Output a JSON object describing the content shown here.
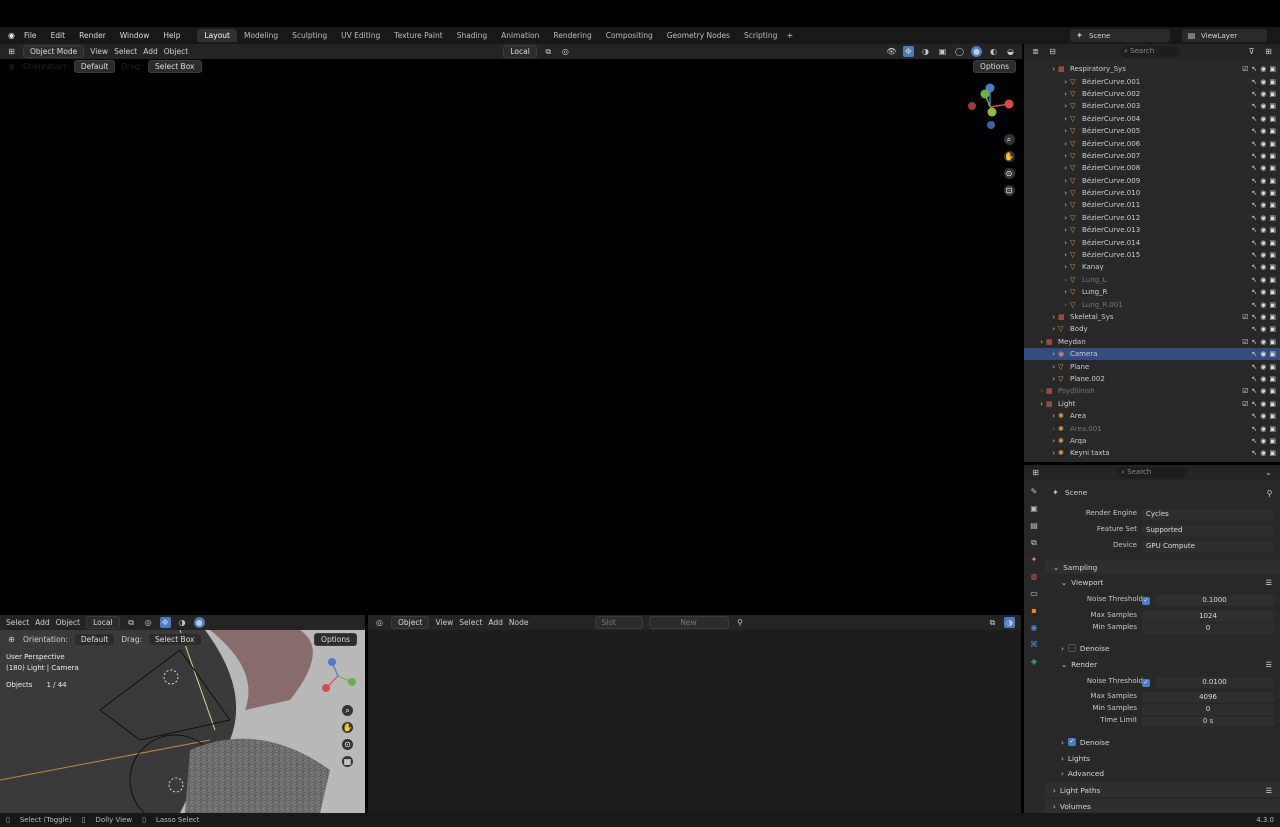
{
  "menu": [
    "File",
    "Edit",
    "Render",
    "Window",
    "Help"
  ],
  "workspaces": [
    "Layout",
    "Modeling",
    "Sculpting",
    "UV Editing",
    "Texture Paint",
    "Shading",
    "Animation",
    "Rendering",
    "Compositing",
    "Geometry Nodes",
    "Scripting"
  ],
  "scene_label": "Scene",
  "viewlayer_label": "ViewLayer",
  "main_view": {
    "mode": "Object Mode",
    "menus": [
      "View",
      "Select",
      "Add",
      "Object"
    ],
    "transform": "Local",
    "orientation_label": "Orientation:",
    "orientation": "Default",
    "drag_label": "Drag:",
    "drag": "Select Box",
    "options": "Options"
  },
  "mini_view": {
    "menus": [
      "Select",
      "Add",
      "Object"
    ],
    "transform": "Local",
    "orientation_label": "Orientation:",
    "orientation": "Default",
    "drag_label": "Drag:",
    "drag": "Select Box",
    "options": "Options",
    "info_line1": "User Perspective",
    "info_line2": "(180) Light | Camera",
    "objects_label": "Objects",
    "objects_value": "1 / 44"
  },
  "node_editor": {
    "type": "Object",
    "menus": [
      "View",
      "Select",
      "Add",
      "Node"
    ],
    "slot": "Slot",
    "new": "New"
  },
  "outliner": {
    "search_placeholder": "Search",
    "rows": [
      {
        "name": "Respiratory_Sys",
        "level": 2,
        "kind": "collection"
      },
      {
        "name": "BézierCurve.001",
        "level": 3,
        "kind": "curve"
      },
      {
        "name": "BézierCurve.002",
        "level": 3,
        "kind": "curve"
      },
      {
        "name": "BézierCurve.003",
        "level": 3,
        "kind": "curve"
      },
      {
        "name": "BézierCurve.004",
        "level": 3,
        "kind": "curve"
      },
      {
        "name": "BézierCurve.005",
        "level": 3,
        "kind": "curve"
      },
      {
        "name": "BézierCurve.006",
        "level": 3,
        "kind": "curve"
      },
      {
        "name": "BézierCurve.007",
        "level": 3,
        "kind": "curve"
      },
      {
        "name": "BézierCurve.008",
        "level": 3,
        "kind": "curve"
      },
      {
        "name": "BézierCurve.009",
        "level": 3,
        "kind": "curve"
      },
      {
        "name": "BézierCurve.010",
        "level": 3,
        "kind": "curve"
      },
      {
        "name": "BézierCurve.011",
        "level": 3,
        "kind": "curve"
      },
      {
        "name": "BézierCurve.012",
        "level": 3,
        "kind": "curve"
      },
      {
        "name": "BézierCurve.013",
        "level": 3,
        "kind": "curve"
      },
      {
        "name": "BézierCurve.014",
        "level": 3,
        "kind": "curve"
      },
      {
        "name": "BézierCurve.015",
        "level": 3,
        "kind": "curve"
      },
      {
        "name": "Kanay",
        "level": 3,
        "kind": "mesh"
      },
      {
        "name": "Lung_L",
        "level": 3,
        "kind": "mesh",
        "dim": true
      },
      {
        "name": "Lung_R",
        "level": 3,
        "kind": "mesh"
      },
      {
        "name": "Lung_R.001",
        "level": 3,
        "kind": "mesh",
        "dim": true
      },
      {
        "name": "Skeletal_Sys",
        "level": 2,
        "kind": "collection"
      },
      {
        "name": "Body",
        "level": 2,
        "kind": "mesh"
      },
      {
        "name": "Meydan",
        "level": 1,
        "kind": "collection"
      },
      {
        "name": "Camera",
        "level": 2,
        "kind": "camera",
        "selected": true
      },
      {
        "name": "Plane",
        "level": 2,
        "kind": "mesh"
      },
      {
        "name": "Plane.002",
        "level": 2,
        "kind": "mesh"
      },
      {
        "name": "Psydllinish",
        "level": 1,
        "kind": "collection",
        "dim": true
      },
      {
        "name": "Light",
        "level": 1,
        "kind": "collection"
      },
      {
        "name": "Area",
        "level": 2,
        "kind": "light"
      },
      {
        "name": "Area.001",
        "level": 2,
        "kind": "light",
        "dim": true
      },
      {
        "name": "Arqa",
        "level": 2,
        "kind": "light"
      },
      {
        "name": "Keyni taxta",
        "level": 2,
        "kind": "light"
      }
    ]
  },
  "properties": {
    "search_placeholder": "Search",
    "context": "Scene",
    "render_engine_label": "Render Engine",
    "render_engine": "Cycles",
    "feature_set_label": "Feature Set",
    "feature_set": "Supported",
    "device_label": "Device",
    "device": "GPU Compute",
    "sampling": "Sampling",
    "viewport": "Viewport",
    "vp_noise_label": "Noise Threshold",
    "vp_noise": "0.1000",
    "vp_max_label": "Max Samples",
    "vp_max": "1024",
    "vp_min_label": "Min Samples",
    "vp_min": "0",
    "vp_denoise": "Denoise",
    "render": "Render",
    "r_noise_label": "Noise Threshold",
    "r_noise": "0.0100",
    "r_max_label": "Max Samples",
    "r_max": "4096",
    "r_min_label": "Min Samples",
    "r_min": "0",
    "r_time_label": "Time Limit",
    "r_time": "0 s",
    "r_denoise": "Denoise",
    "lights": "Lights",
    "advanced": "Advanced",
    "light_paths": "Light Paths",
    "volumes": "Volumes"
  },
  "statusbar": {
    "select": "Select (Toggle)",
    "dolly": "Dolly View",
    "lasso": "Lasso Select",
    "version": "4.3.0"
  },
  "colors": {
    "accent": "#4b7cc8",
    "selection": "#334d80",
    "camera_frame": "#d8d88a"
  }
}
